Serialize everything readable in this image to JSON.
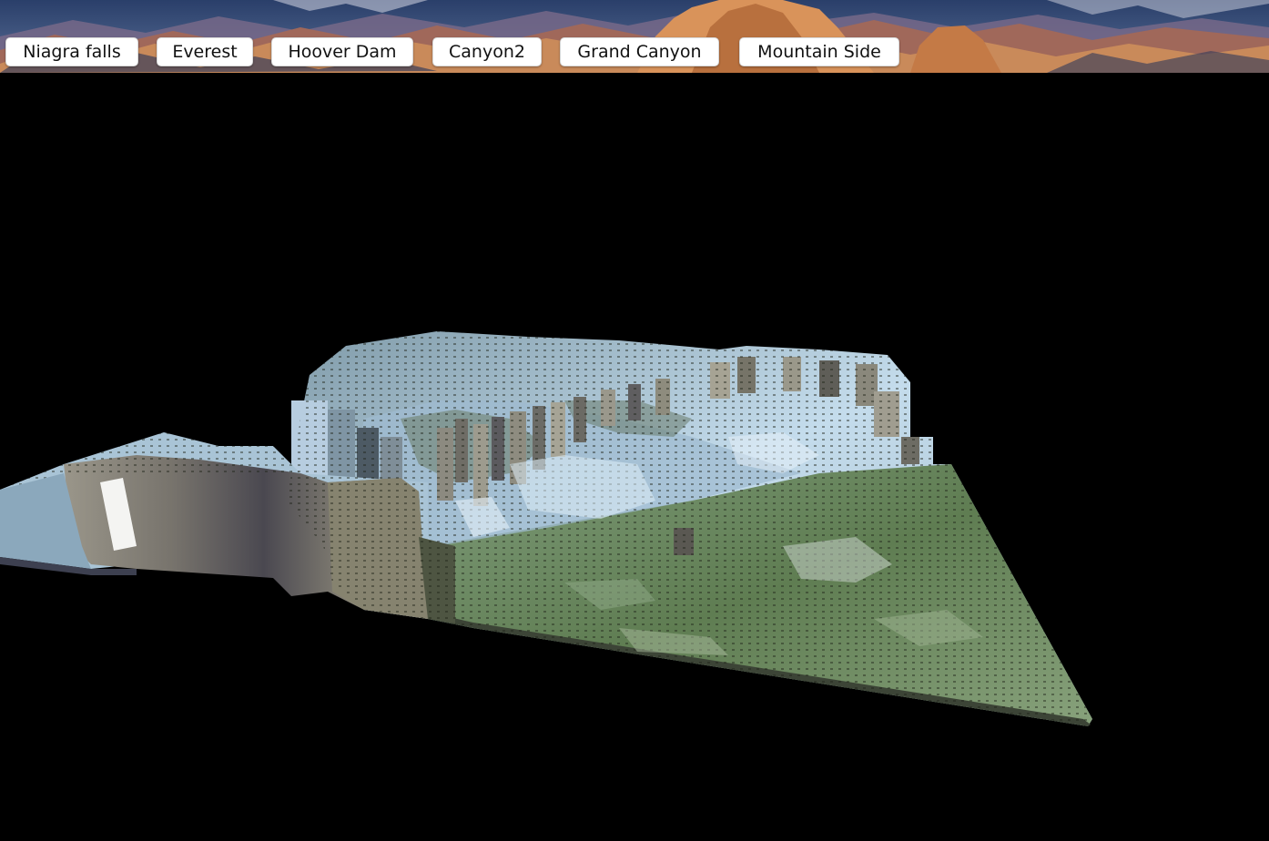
{
  "toolbar": {
    "buttons": [
      {
        "label": "Niagra falls"
      },
      {
        "label": "Everest"
      },
      {
        "label": "Hoover Dam"
      },
      {
        "label": "Canyon2"
      },
      {
        "label": "Grand Canyon"
      },
      {
        "label": "Mountain Side"
      }
    ]
  },
  "colors": {
    "viewport_background": "#000000",
    "button_background": "#ffffff",
    "button_text": "#111111",
    "terrain_snow": "#b9d3e8",
    "terrain_grass": "#6e8a5e",
    "terrain_cliff": "#8e8b7e",
    "terrain_shadow": "#3f3e44"
  }
}
